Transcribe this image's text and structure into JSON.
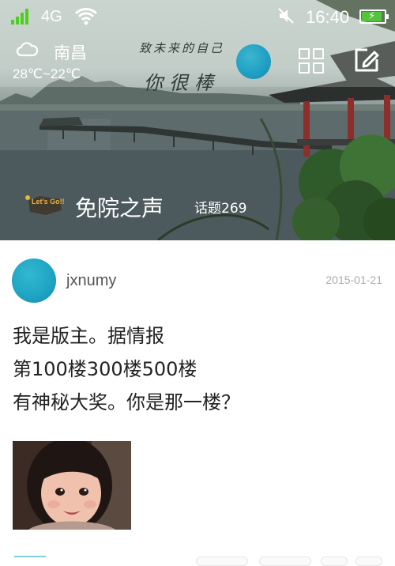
{
  "status_bar": {
    "network": "4G",
    "time": "16:40",
    "signal_icon": "signal-bars-icon",
    "wifi_icon": "wifi-icon",
    "mute_icon": "mute-icon",
    "battery_icon": "battery-charging-icon",
    "battery_level": 0.9
  },
  "header": {
    "weather_icon": "cloud-icon",
    "city": "南昌",
    "temperature": "28℃~22℃",
    "slogan_line1": "致未来的自己",
    "slogan_line2": "你很棒",
    "badge_text": "Let's Go!!",
    "forum_name": "免院之声",
    "topic_count": "话题269",
    "grid_icon": "grid-icon",
    "edit_icon": "edit-icon"
  },
  "post": {
    "username": "jxnumy",
    "date": "2015-01-21",
    "lines": [
      "我是版主。据情报",
      "第100楼300楼500楼",
      "有神秘大奖。你是那一楼？"
    ],
    "image_icon": "child-photo"
  },
  "colors": {
    "accent": "#1ea3c3",
    "signal": "#4cd11a",
    "battery": "#53c43c"
  }
}
